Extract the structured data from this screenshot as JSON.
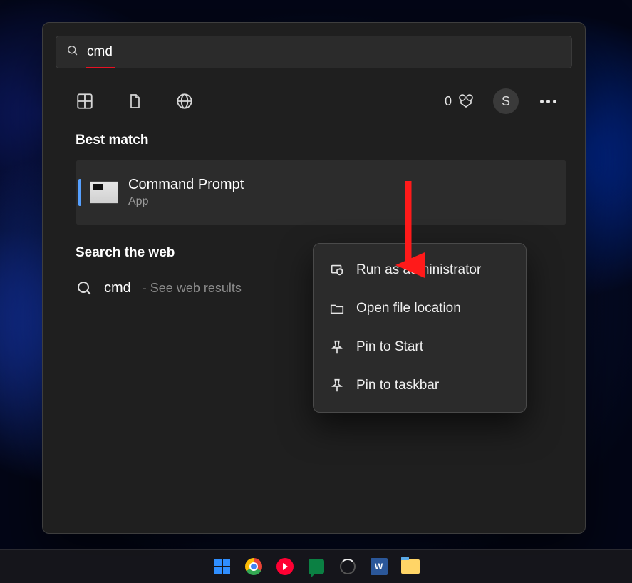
{
  "search": {
    "value": "cmd"
  },
  "toolbar": {
    "points": "0",
    "avatar_initial": "S"
  },
  "sections": {
    "best_match": "Best match",
    "search_web": "Search the web"
  },
  "best_match": {
    "title": "Command Prompt",
    "subtitle": "App"
  },
  "web": {
    "query": "cmd",
    "hint": "- See web results"
  },
  "context_menu": {
    "run_admin": "Run as administrator",
    "open_location": "Open file location",
    "pin_start": "Pin to Start",
    "pin_taskbar": "Pin to taskbar"
  },
  "taskbar": {
    "word_label": "W"
  }
}
